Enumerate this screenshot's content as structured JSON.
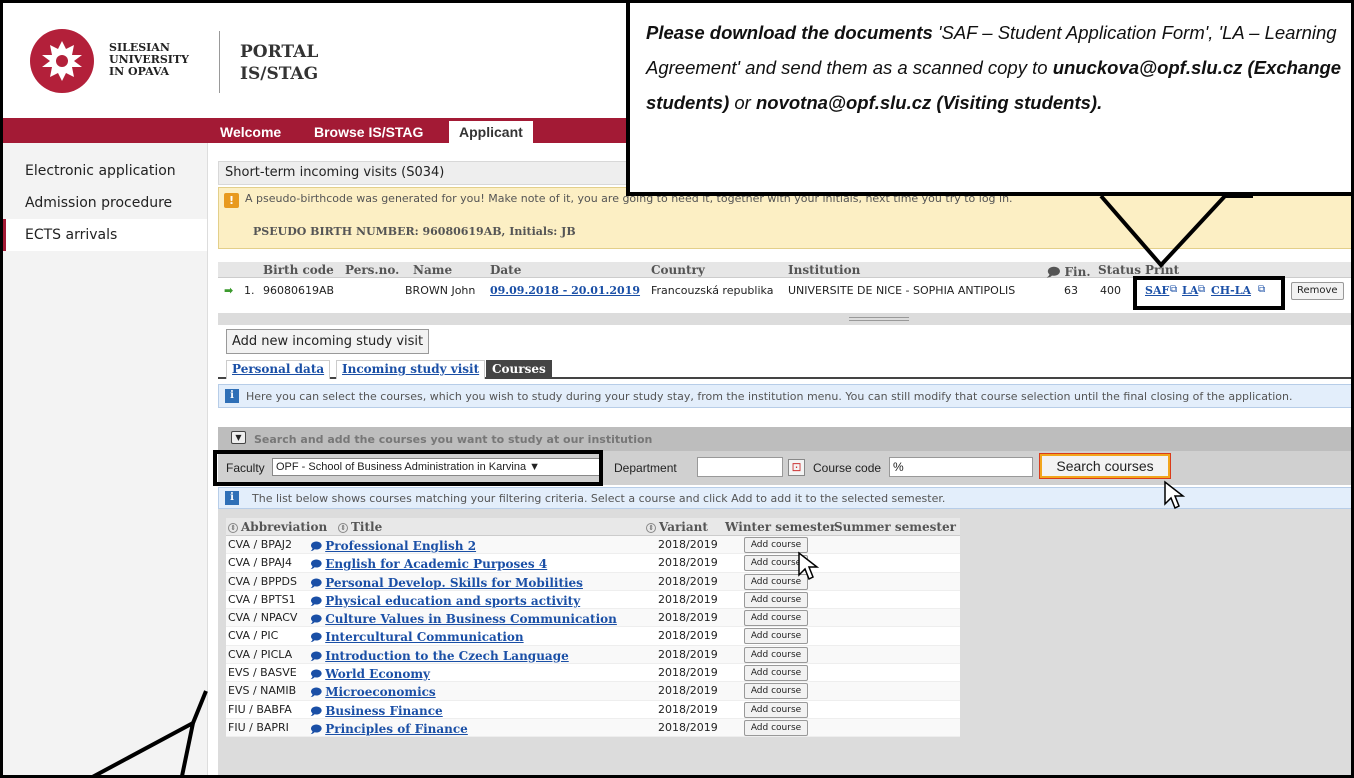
{
  "header": {
    "university_line1": "SILESIAN",
    "university_line2": "UNIVERSITY",
    "university_line3": "IN OPAVA",
    "portal_line1": "PORTAL",
    "portal_line2": "IS/STAG"
  },
  "nav": {
    "tabs": [
      "Welcome",
      "Browse IS/STAG",
      "Applicant"
    ],
    "active": "Applicant"
  },
  "sidebar": {
    "items": [
      "Electronic application",
      "Admission procedure",
      "ECTS arrivals"
    ],
    "active": "ECTS arrivals"
  },
  "section_title": "Short-term incoming visits (S034)",
  "warning": {
    "text": "A pseudo-birthcode was generated for you! Make note of it, you are going to need it, together with your initials, next time you try to log in.",
    "pseudo": "PSEUDO BIRTH NUMBER: 96080619AB, Initials: JB"
  },
  "visit_table": {
    "headers": {
      "birth_code": "Birth code",
      "pers_no": "Pers.no.",
      "name": "Name",
      "date": "Date",
      "country": "Country",
      "institution": "Institution",
      "fin": "Fin.",
      "status": "Status",
      "print": "Print"
    },
    "row": {
      "index": "1.",
      "birth_code": "96080619AB",
      "pers_no": "",
      "name": "BROWN John",
      "date": "09.09.2018 - 20.01.2019",
      "country": "Francouzská republika",
      "institution": "UNIVERSITE DE NICE - SOPHIA ANTIPOLIS",
      "fin": "63",
      "status": "400",
      "print_links": [
        "SAF",
        "LA",
        "CH-LA"
      ],
      "remove": "Remove"
    }
  },
  "add_visit_button": "Add new incoming study visit",
  "sub_tabs": [
    "Personal data",
    "Incoming study visit",
    "Courses"
  ],
  "courses_info": "Here you can select the courses, which you wish to study during your study stay, from the institution menu. You can still modify that course selection until the final closing of the application.",
  "search": {
    "title": "Search and add the courses you want to study at our institution",
    "faculty_label": "Faculty",
    "faculty_value": "OPF - School of Business Administration in Karvina ▼",
    "department_label": "Department",
    "department_value": "",
    "course_code_label": "Course code",
    "course_code_value": "%",
    "search_button": "Search courses"
  },
  "list_info": "The list below shows courses matching your filtering criteria. Select a course and click Add to add it to the selected semester.",
  "course_table": {
    "headers": {
      "abbreviation": "Abbreviation",
      "title": "Title",
      "variant": "Variant",
      "winter": "Winter semester",
      "summer": "Summer semester"
    },
    "add_label": "Add course",
    "rows": [
      {
        "abbr": "CVA / BPAJ2",
        "title": "Professional English 2",
        "variant": "2018/2019"
      },
      {
        "abbr": "CVA / BPAJ4",
        "title": "English for Academic Purposes 4",
        "variant": "2018/2019"
      },
      {
        "abbr": "CVA / BPPDS",
        "title": "Personal Develop. Skills for Mobilities",
        "variant": "2018/2019"
      },
      {
        "abbr": "CVA / BPTS1",
        "title": "Physical education and sports activity",
        "variant": "2018/2019"
      },
      {
        "abbr": "CVA / NPACV",
        "title": "Culture Values in Business Communication",
        "variant": "2018/2019"
      },
      {
        "abbr": "CVA / PIC",
        "title": "Intercultural Communication",
        "variant": "2018/2019"
      },
      {
        "abbr": "CVA / PICLA",
        "title": "Introduction to the Czech Language",
        "variant": "2018/2019"
      },
      {
        "abbr": "EVS / BASVE",
        "title": "World Economy",
        "variant": "2018/2019"
      },
      {
        "abbr": "EVS / NAMIB",
        "title": "Microeconomics",
        "variant": "2018/2019"
      },
      {
        "abbr": "FIU / BABFA",
        "title": "Business Finance",
        "variant": "2018/2019"
      },
      {
        "abbr": "FIU / BAPRI",
        "title": "Principles of Finance",
        "variant": "2018/2019"
      }
    ]
  },
  "callout": {
    "t1": "Please download the documents",
    "t2": " 'SAF – Student Application Form', 'LA – Learning Agreement' and send them as a scanned copy to ",
    "t3": "unuckova@opf.slu.cz (Exchange students)",
    "t4": " or ",
    "t5": "novotna@opf.slu.cz (Visiting students)."
  },
  "colors": {
    "brand": "#a31a35",
    "link": "#1a4fa6",
    "warning_bg": "#fcefc4",
    "info_bg": "#e3eefb",
    "search_button_border": "#f2a61c"
  }
}
